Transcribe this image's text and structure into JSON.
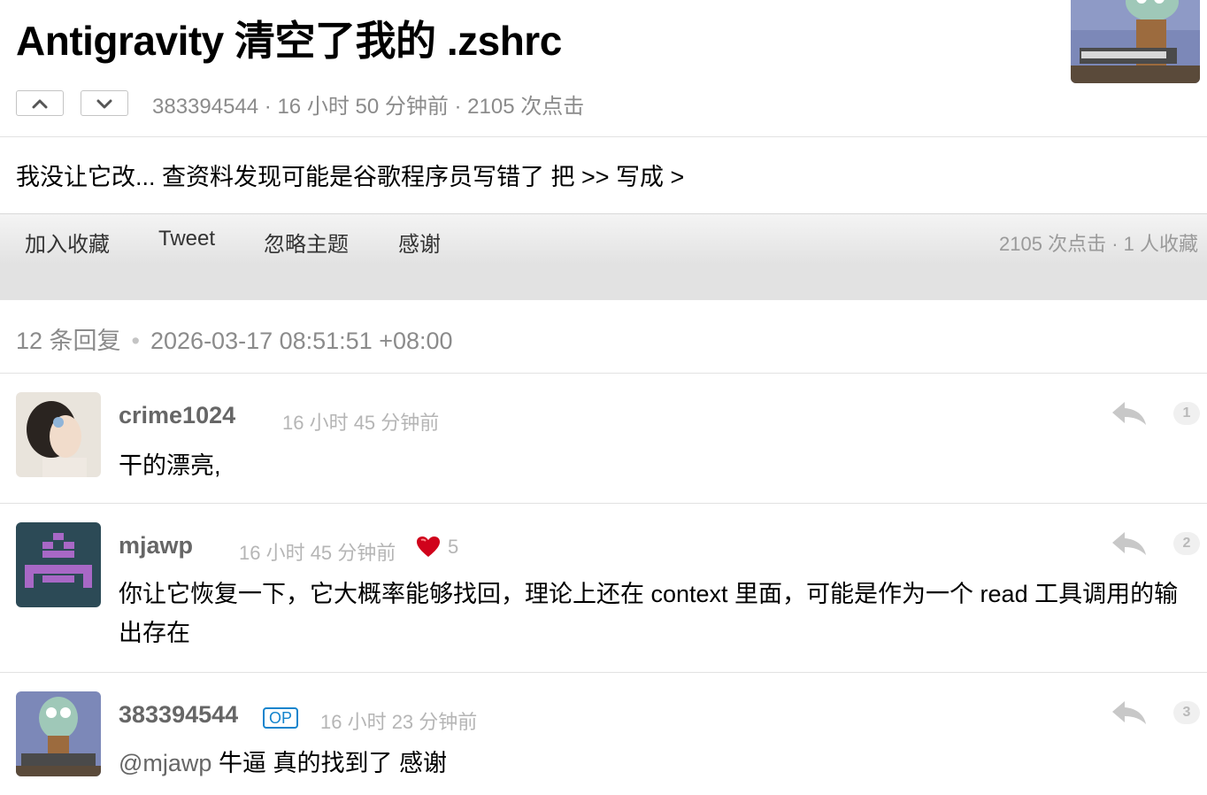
{
  "topic": {
    "title": "Antigravity 清空了我的 .zshrc",
    "meta": "383394544 · 16 小时 50 分钟前 · 2105 次点击",
    "body": "我没让它改... 查资料发现可能是谷歌程序员写错了 把 >> 写成 >"
  },
  "toolbar": {
    "favorite_label": "加入收藏",
    "tweet_label": "Tweet",
    "ignore_label": "忽略主题",
    "thank_label": "感谢",
    "stats": "2105 次点击 · 1 人收藏"
  },
  "replies_summary": {
    "count": "12 条回复",
    "datetime": "2026-03-17 08:51:51 +08:00"
  },
  "replies": [
    {
      "username": "crime1024",
      "time": "16 小时 45 分钟前",
      "text": "干的漂亮,",
      "number": "1",
      "thanks": ""
    },
    {
      "username": "mjawp",
      "time": "16 小时 45 分钟前",
      "text": "你让它恢复一下，它大概率能够找回，理论上还在 context 里面，可能是作为一个 read 工具调用的输出存在",
      "number": "2",
      "thanks": "5"
    },
    {
      "username": "383394544",
      "op_badge": "OP",
      "time": "16 小时 23 分钟前",
      "mention": "@mjawp",
      "text": " 牛逼 真的找到了 感谢",
      "number": "3",
      "thanks": ""
    }
  ],
  "icons": {
    "upvote": "chevron-up-icon",
    "downvote": "chevron-down-icon",
    "reply": "reply-arrow-icon",
    "thanks": "heart-icon"
  },
  "colors": {
    "op_badge": "#1484cd",
    "meta_gray": "#8b8b8b",
    "heart": "#d0021b"
  }
}
